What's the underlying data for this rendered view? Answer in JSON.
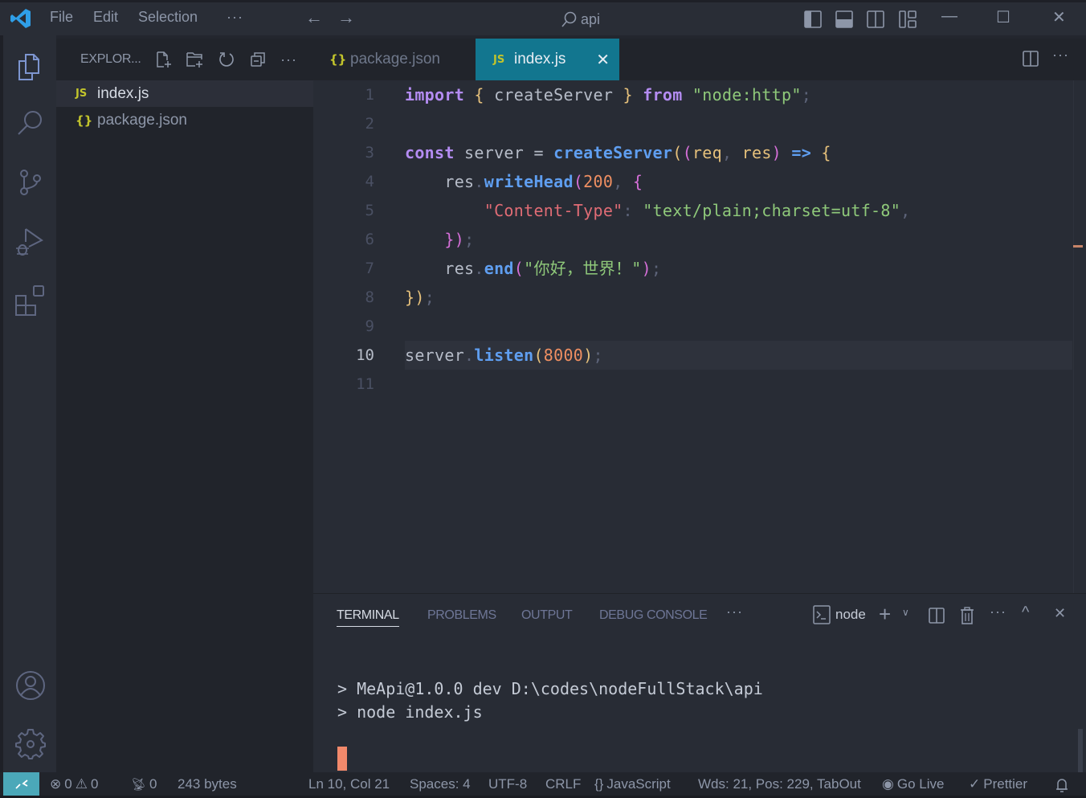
{
  "titlebar": {
    "menu": [
      "File",
      "Edit",
      "Selection",
      "···"
    ],
    "search_text": "api",
    "colors": {
      "logo": "#2f9fe8"
    }
  },
  "activity_bar": {
    "items": [
      {
        "name": "explorer",
        "icon": "files-icon",
        "active": true
      },
      {
        "name": "search",
        "icon": "search-icon"
      },
      {
        "name": "source-control",
        "icon": "source-control-icon"
      },
      {
        "name": "run-debug",
        "icon": "run-debug-icon"
      },
      {
        "name": "extensions",
        "icon": "extensions-icon"
      }
    ],
    "bottom": [
      {
        "name": "accounts",
        "icon": "account-icon"
      },
      {
        "name": "manage",
        "icon": "gear-icon"
      }
    ]
  },
  "sidebar": {
    "title": "EXPLOR...",
    "files": [
      {
        "icon_text": "JS",
        "name": "index.js",
        "active": true
      },
      {
        "icon_text": "{}",
        "name": "package.json",
        "active": false
      }
    ]
  },
  "tabs": [
    {
      "icon_text": "{}",
      "label": "package.json",
      "active": false
    },
    {
      "icon_text": "JS",
      "label": "index.js",
      "active": true,
      "close": "✕"
    }
  ],
  "editor": {
    "current_line": 10,
    "lines": [
      {
        "n": "1",
        "text": "import { createServer } from \"node:http\";"
      },
      {
        "n": "2",
        "text": ""
      },
      {
        "n": "3",
        "text": "const server = createServer((req, res) => {"
      },
      {
        "n": "4",
        "text": "    res.writeHead(200, {"
      },
      {
        "n": "5",
        "text": "        \"Content-Type\": \"text/plain;charset=utf-8\","
      },
      {
        "n": "6",
        "text": "    });"
      },
      {
        "n": "7",
        "text": "    res.end(\"你好，世界！\");"
      },
      {
        "n": "8",
        "text": "});"
      },
      {
        "n": "9",
        "text": ""
      },
      {
        "n": "10",
        "text": "server.listen(8000);"
      },
      {
        "n": "11",
        "text": ""
      }
    ]
  },
  "panel": {
    "tabs": [
      "TERMINAL",
      "PROBLEMS",
      "OUTPUT",
      "DEBUG CONSOLE"
    ],
    "active_tab": "TERMINAL",
    "more": "···",
    "terminal_name": "node",
    "terminal_lines": [
      "> MeApi@1.0.0 dev D:\\codes\\nodeFullStack\\api",
      "> node index.js"
    ]
  },
  "statusbar": {
    "errors": "0",
    "warnings": "0",
    "ports": "0",
    "file_size": "243 bytes",
    "cursor": "Ln 10, Col 21",
    "indent": "Spaces: 4",
    "encoding": "UTF-8",
    "eol": "CRLF",
    "language": "JavaScript",
    "word_count": "Wds: 21, Pos: 229, TabOut",
    "go_live": "Go Live",
    "prettier": "Prettier",
    "colors": {
      "remote": "#4ba8b9"
    }
  }
}
